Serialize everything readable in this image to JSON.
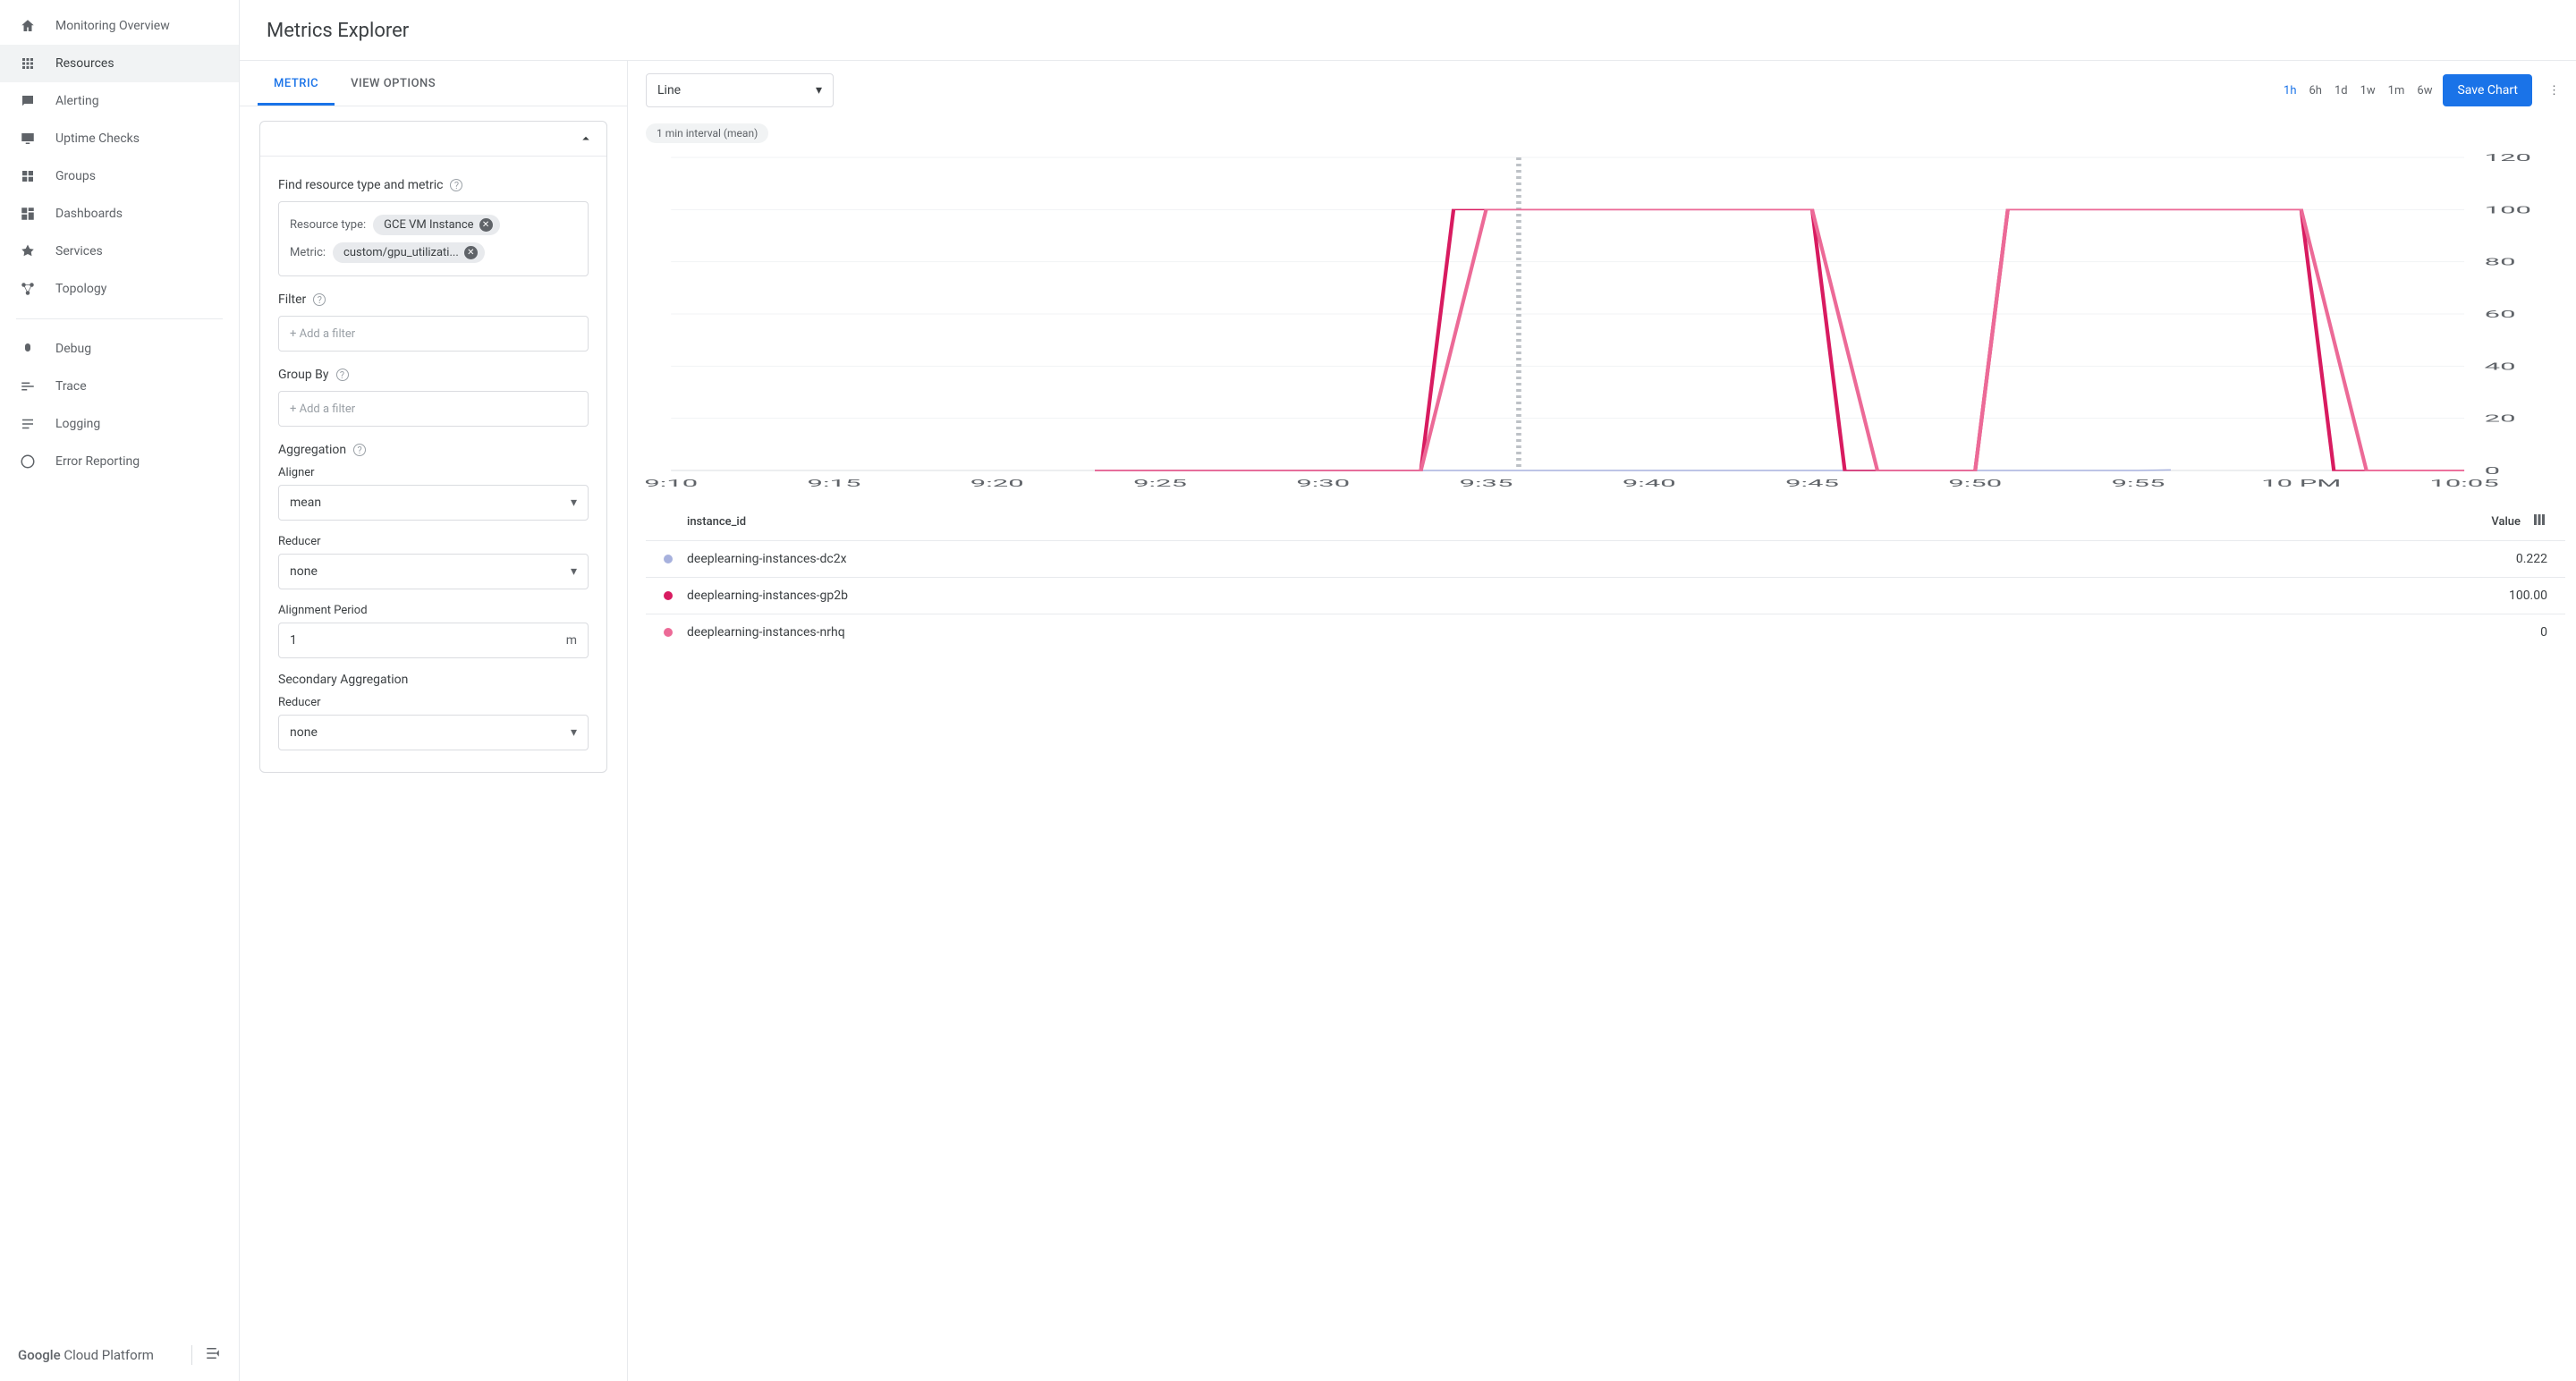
{
  "sidebar": {
    "items": [
      {
        "icon": "home",
        "label": "Monitoring Overview"
      },
      {
        "icon": "apps",
        "label": "Resources",
        "active": true
      },
      {
        "icon": "chat",
        "label": "Alerting"
      },
      {
        "icon": "screen",
        "label": "Uptime Checks"
      },
      {
        "icon": "group",
        "label": "Groups"
      },
      {
        "icon": "dashboard",
        "label": "Dashboards"
      },
      {
        "icon": "services",
        "label": "Services"
      },
      {
        "icon": "topology",
        "label": "Topology"
      }
    ],
    "secondary": [
      {
        "icon": "debug",
        "label": "Debug"
      },
      {
        "icon": "trace",
        "label": "Trace"
      },
      {
        "icon": "logging",
        "label": "Logging"
      },
      {
        "icon": "error",
        "label": "Error Reporting"
      }
    ],
    "brand": "Google Cloud Platform"
  },
  "page": {
    "title": "Metrics Explorer"
  },
  "tabs": {
    "metric": "METRIC",
    "view": "VIEW OPTIONS"
  },
  "find": {
    "title": "Find resource type and metric",
    "resource_label": "Resource type:",
    "resource_value": "GCE VM Instance",
    "metric_label": "Metric:",
    "metric_value": "custom/gpu_utilizati..."
  },
  "filter": {
    "title": "Filter",
    "placeholder": "+ Add a filter"
  },
  "groupby": {
    "title": "Group By",
    "placeholder": "+ Add a filter"
  },
  "agg": {
    "title": "Aggregation",
    "aligner_label": "Aligner",
    "aligner_value": "mean",
    "reducer_label": "Reducer",
    "reducer_value": "none",
    "period_label": "Alignment Period",
    "period_value": "1",
    "period_unit": "m"
  },
  "secagg": {
    "title": "Secondary Aggregation",
    "reducer_label": "Reducer",
    "reducer_value": "none"
  },
  "toolbar": {
    "chart_type": "Line",
    "ranges": [
      "1h",
      "6h",
      "1d",
      "1w",
      "1m",
      "6w"
    ],
    "active_range": "1h",
    "save": "Save Chart"
  },
  "interval": "1 min interval (mean)",
  "legend": {
    "id_header": "instance_id",
    "val_header": "Value",
    "rows": [
      {
        "color": "#a7b1dd",
        "name": "deeplearning-instances-dc2x",
        "value": "0.222"
      },
      {
        "color": "#d81b60",
        "name": "deeplearning-instances-gp2b",
        "value": "100.00"
      },
      {
        "color": "#ec6a97",
        "name": "deeplearning-instances-nrhq",
        "value": "0"
      }
    ]
  },
  "chart_data": {
    "type": "line",
    "xlabel": "",
    "ylabel": "",
    "ylim": [
      0,
      120
    ],
    "y_ticks": [
      0,
      20,
      40,
      60,
      80,
      100,
      120
    ],
    "x_ticks": [
      "9:10",
      "9:15",
      "9:20",
      "9:25",
      "9:30",
      "9:35",
      "9:40",
      "9:45",
      "9:50",
      "9:55",
      "10 PM",
      "10:05"
    ],
    "cursor_x": "9:36",
    "series": [
      {
        "name": "deeplearning-instances-dc2x",
        "color": "#a7b1dd",
        "x": [
          "9:23",
          "9:55",
          "9:56"
        ],
        "y": [
          0,
          0,
          0.222
        ]
      },
      {
        "name": "deeplearning-instances-gp2b",
        "color": "#d81b60",
        "x": [
          "9:23",
          "9:33",
          "9:34",
          "9:45",
          "9:46",
          "9:50",
          "9:51",
          "10:00",
          "10:01",
          "10:05"
        ],
        "y": [
          0,
          0,
          100,
          100,
          0,
          0,
          100,
          100,
          0,
          0
        ]
      },
      {
        "name": "deeplearning-instances-nrhq",
        "color": "#ec6a97",
        "x": [
          "9:23",
          "9:33",
          "9:35",
          "9:45",
          "9:47",
          "9:50",
          "9:51",
          "10:00",
          "10:02",
          "10:05"
        ],
        "y": [
          0,
          0,
          100,
          100,
          0,
          0,
          100,
          100,
          0,
          0
        ]
      }
    ]
  }
}
